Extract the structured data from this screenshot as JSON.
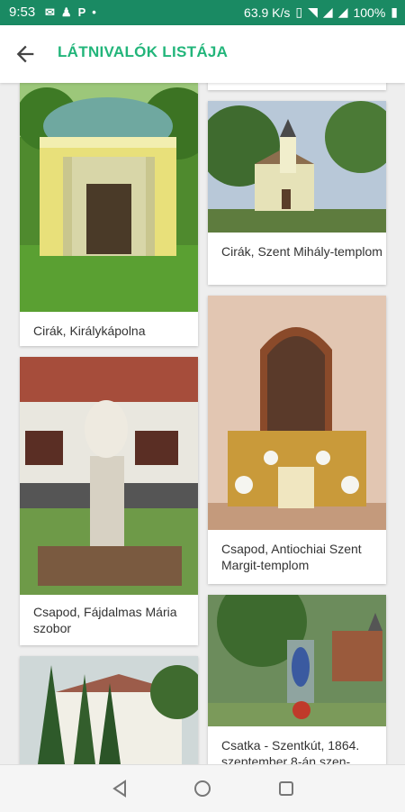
{
  "status": {
    "time": "9:53",
    "speed": "63.9 K/s",
    "battery": "100%"
  },
  "header": {
    "title": "LÁTNIVALÓK LISTÁJA"
  },
  "cards": [
    {
      "caption": "Cirák, Királykápolna"
    },
    {
      "caption": "Cirák, Szent Mihály-templom"
    },
    {
      "caption": "Csapod, Fájdalmas Mária szobor"
    },
    {
      "caption": "Csapod, Antiochiai Szent Margit-templom"
    },
    {
      "caption": ""
    },
    {
      "caption": "Csatka - Szentkút, 1864. szeptember 8-án szen-"
    }
  ]
}
